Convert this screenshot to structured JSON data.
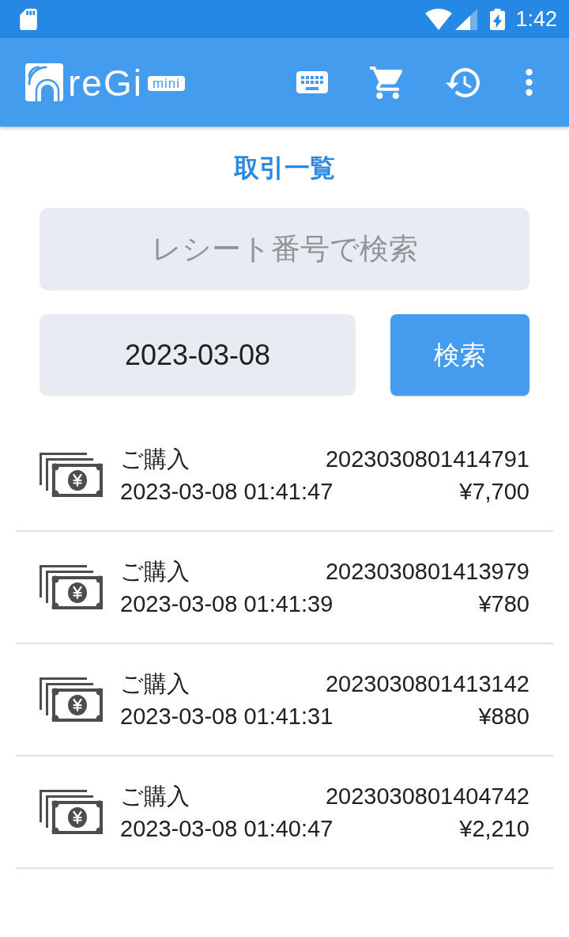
{
  "status_bar": {
    "time": "1:42"
  },
  "app_bar": {
    "logo": {
      "wordmark": "reGi",
      "suffix": "mini"
    }
  },
  "page_title": "取引一覧",
  "receipt_search": {
    "placeholder": "レシート番号で検索"
  },
  "date_field": {
    "value": "2023-03-08"
  },
  "search_button": {
    "label": "検索"
  },
  "transactions": [
    {
      "label": "ご購入",
      "receipt_number": "2023030801414791",
      "datetime": "2023-03-08 01:41:47",
      "amount": "¥7,700"
    },
    {
      "label": "ご購入",
      "receipt_number": "2023030801413979",
      "datetime": "2023-03-08 01:41:39",
      "amount": "¥780"
    },
    {
      "label": "ご購入",
      "receipt_number": "2023030801413142",
      "datetime": "2023-03-08 01:41:31",
      "amount": "¥880"
    },
    {
      "label": "ご購入",
      "receipt_number": "2023030801404742",
      "datetime": "2023-03-08 01:40:47",
      "amount": "¥2,210"
    }
  ]
}
